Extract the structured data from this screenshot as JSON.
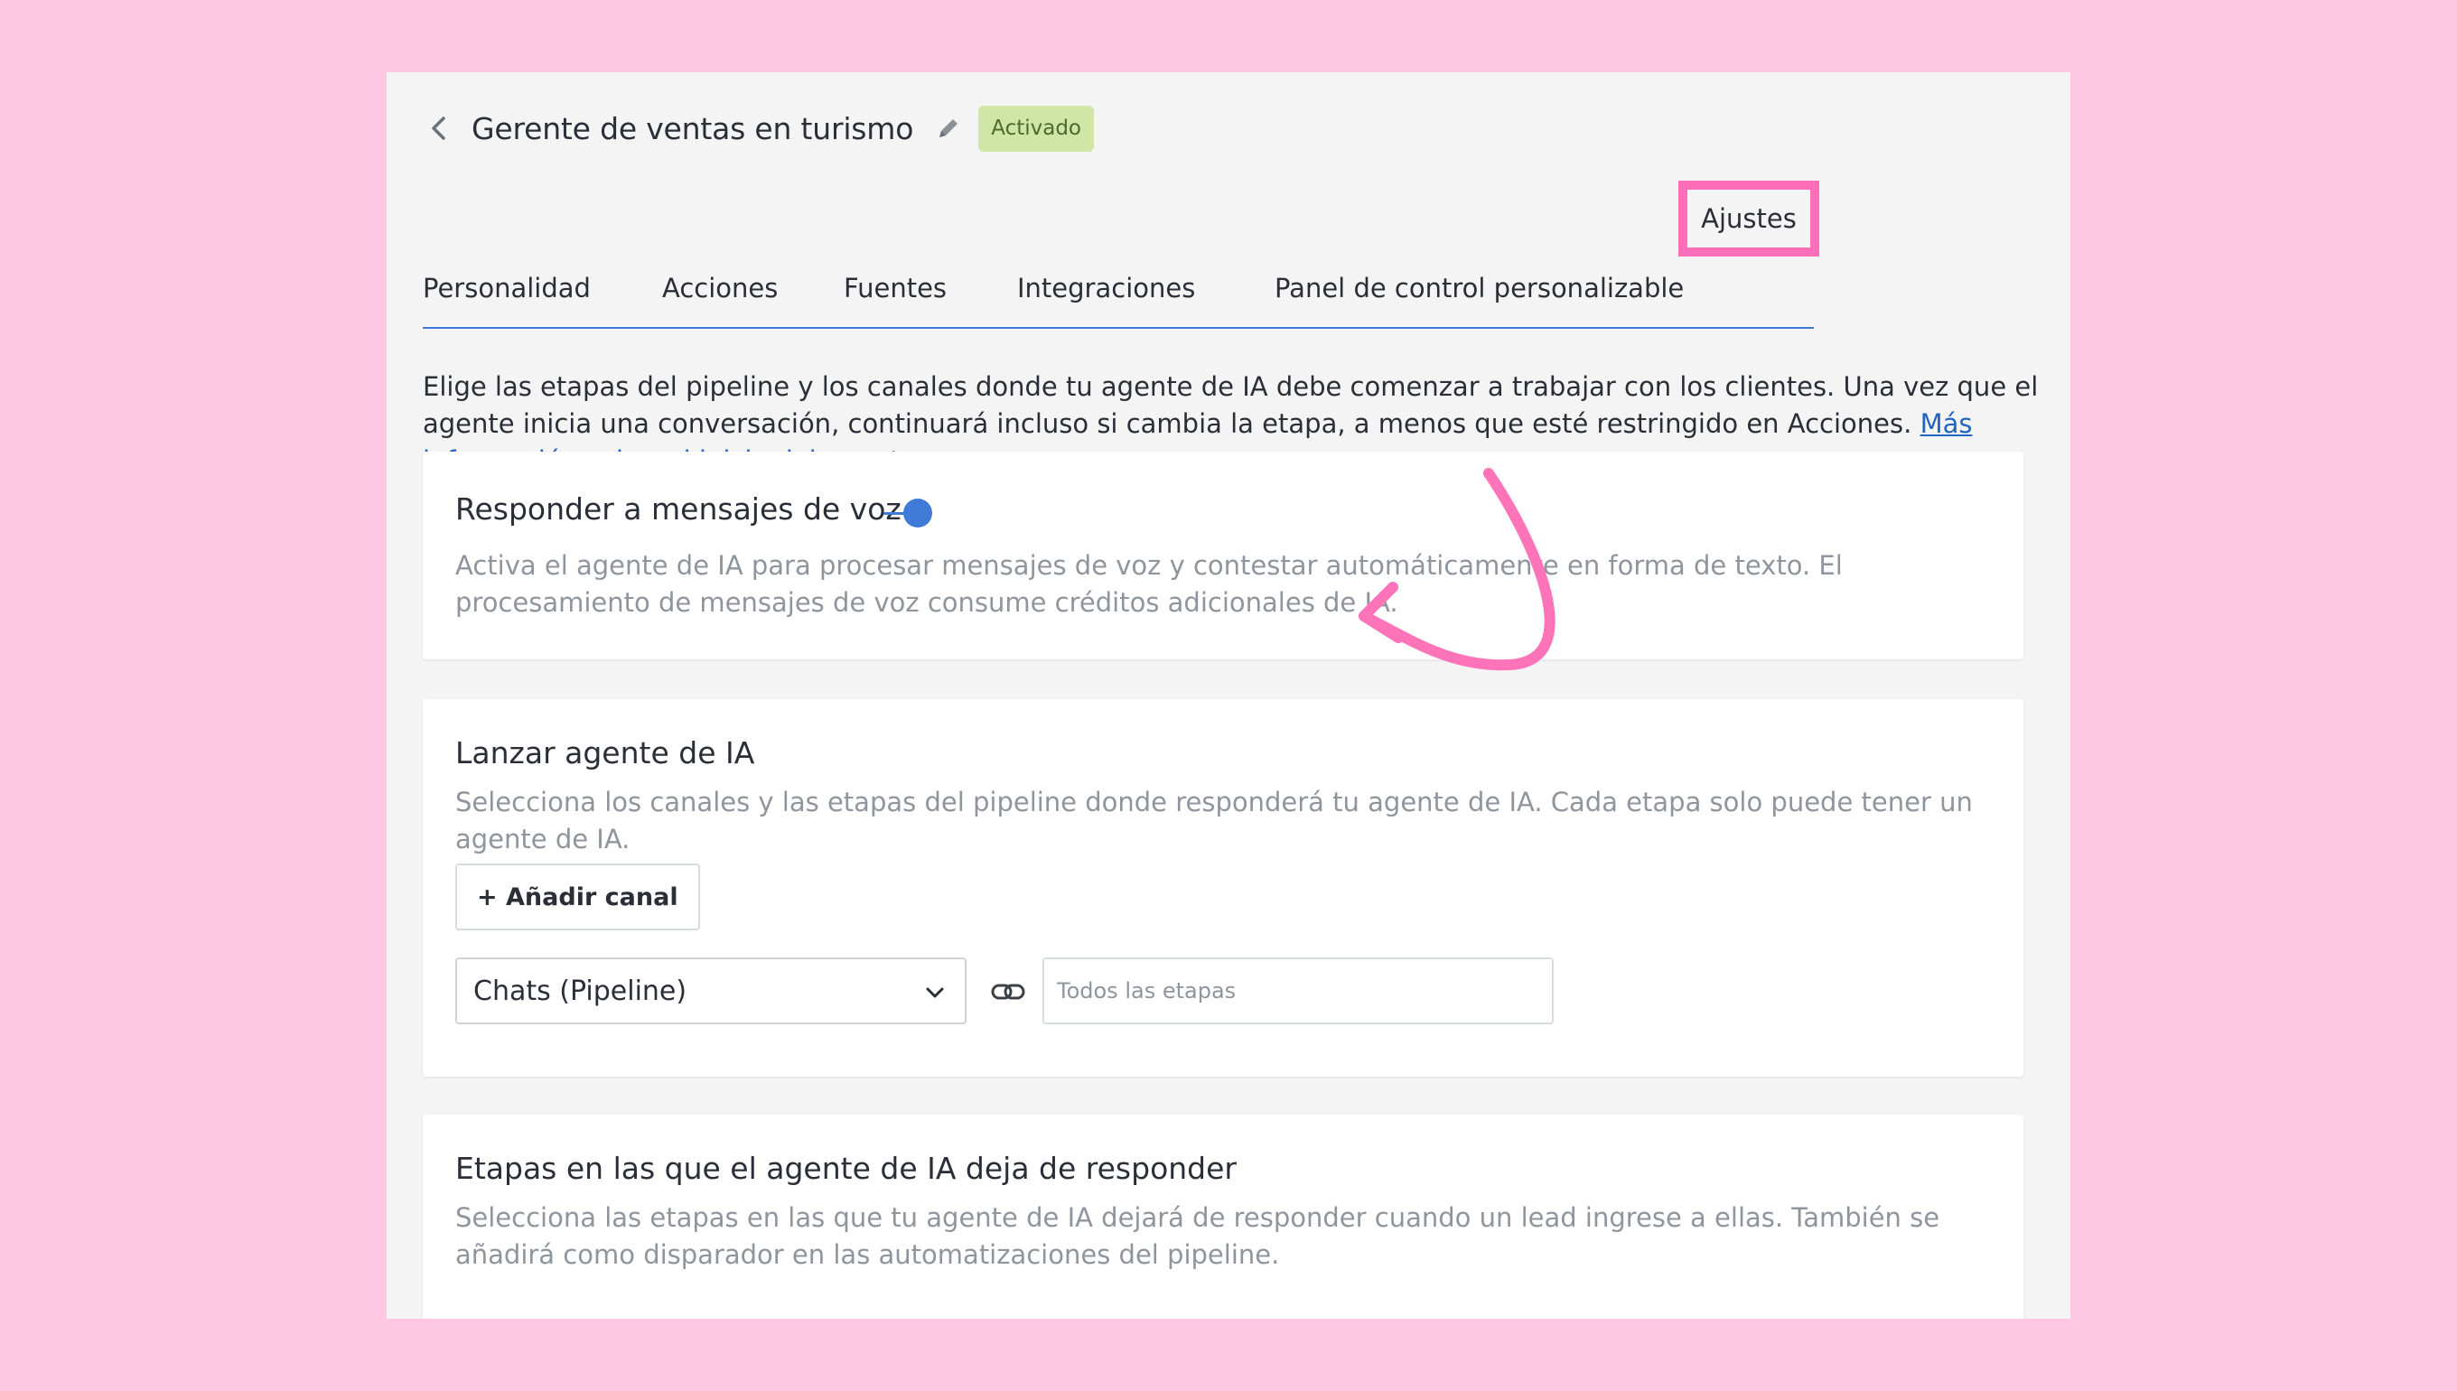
{
  "header": {
    "title": "Gerente de ventas en turismo",
    "status_badge": "Activado"
  },
  "tabs": [
    {
      "label": "Personalidad"
    },
    {
      "label": "Acciones"
    },
    {
      "label": "Fuentes"
    },
    {
      "label": "Integraciones"
    },
    {
      "label": "Panel de control personalizable"
    },
    {
      "label": "Ajustes"
    }
  ],
  "active_tab": "Ajustes",
  "intro": {
    "text": "Elige las etapas del pipeline y los canales donde tu agente de IA debe comenzar a trabajar con los clientes. Una vez que el agente inicia una conversación, continuará incluso si cambia la etapa, a menos que esté restringido en Acciones. ",
    "link": "Más información sobre el inicio del agente."
  },
  "voice_card": {
    "title": "Responder a mensajes de voz",
    "toggle_on": true,
    "description": "Activa el agente de IA para procesar mensajes de voz y contestar automáticamente en forma de texto. El procesamiento de mensajes de voz consume créditos adicionales de IA."
  },
  "launch_card": {
    "title": "Lanzar agente de IA",
    "description": "Selecciona los canales y las etapas del pipeline donde responderá tu agente de IA. Cada etapa solo puede tener un agente de IA.",
    "add_channel_label": "+ Añadir canal",
    "channel_select_value": "Chats (Pipeline)",
    "stages_placeholder": "Todos las etapas"
  },
  "stop_card": {
    "title": "Etapas en las que el agente de IA deja de responder",
    "description": "Selecciona las etapas en las que tu agente de IA dejará de responder cuando un lead ingrese a ellas. También se añadirá como disparador en las automatizaciones del pipeline."
  },
  "colors": {
    "background": "#ffc8e2",
    "accent": "#3f7bd6",
    "highlight": "#ff6eb8",
    "badge_bg": "#cfe6a6",
    "link": "#1f66c1"
  }
}
